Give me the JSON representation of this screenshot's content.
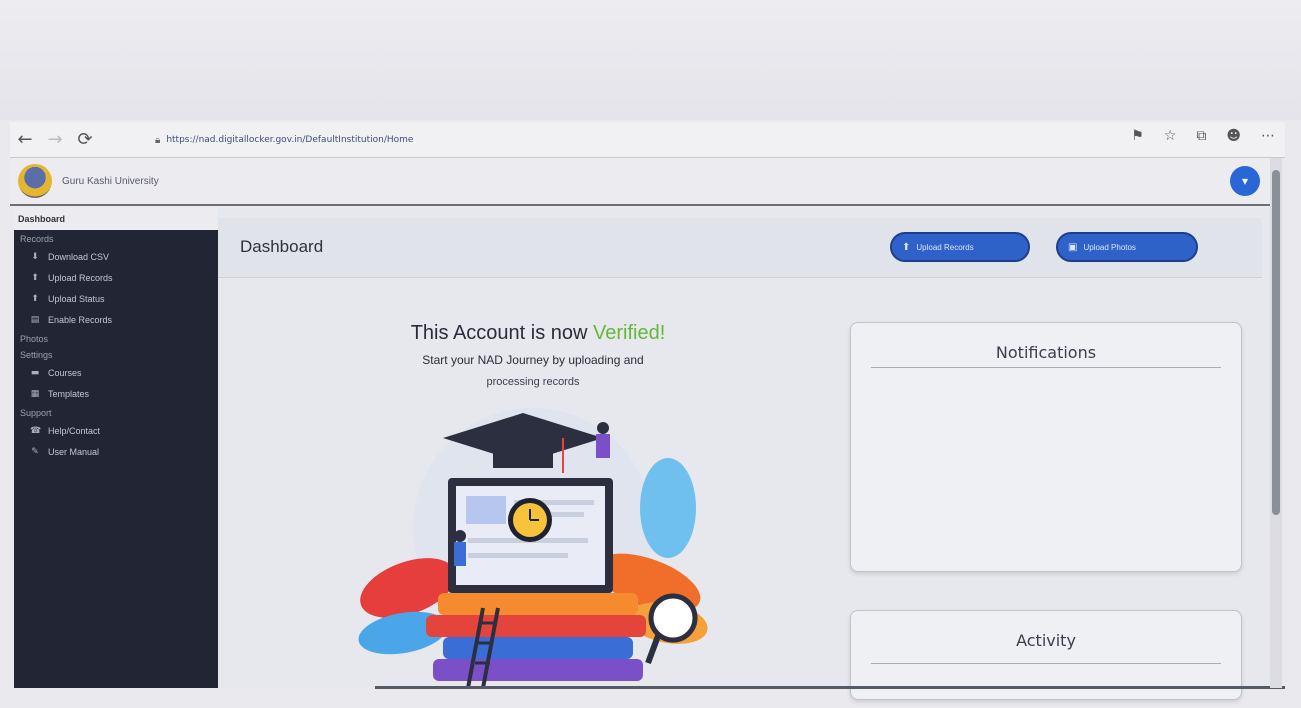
{
  "browser": {
    "url": "https://nad.digitallocker.gov.in/DefaultInstitution/Home"
  },
  "header": {
    "org_name": "Guru Kashi University"
  },
  "sidebar": {
    "top_label": "Dashboard",
    "sections": [
      {
        "title": "Records",
        "items": [
          {
            "icon": "download-icon",
            "label": "Download CSV"
          },
          {
            "icon": "upload-icon",
            "label": "Upload Records"
          },
          {
            "icon": "upload-icon",
            "label": "Upload Status"
          },
          {
            "icon": "file-icon",
            "label": "Enable Records"
          }
        ]
      },
      {
        "title": "Photos",
        "items": []
      },
      {
        "title": "Settings",
        "items": [
          {
            "icon": "minus-icon",
            "label": "Courses"
          },
          {
            "icon": "template-icon",
            "label": "Templates"
          }
        ]
      },
      {
        "title": "Support",
        "items": [
          {
            "icon": "help-icon",
            "label": "Help/Contact"
          },
          {
            "icon": "book-icon",
            "label": "User Manual"
          }
        ]
      }
    ]
  },
  "main": {
    "title": "Dashboard",
    "buttons": {
      "upload_records": "Upload Records",
      "upload_photos": "Upload Photos"
    },
    "welcome": {
      "line1_prefix": "This Account is now ",
      "line1_highlight": "Verified!",
      "line2": "Start your NAD Journey by uploading and",
      "line3": "processing records"
    },
    "notifications_title": "Notifications",
    "activity_title": "Activity"
  },
  "colors": {
    "sidebar_bg": "#222634",
    "accent_button": "#2e62c9",
    "verified_green": "#63b83a"
  }
}
